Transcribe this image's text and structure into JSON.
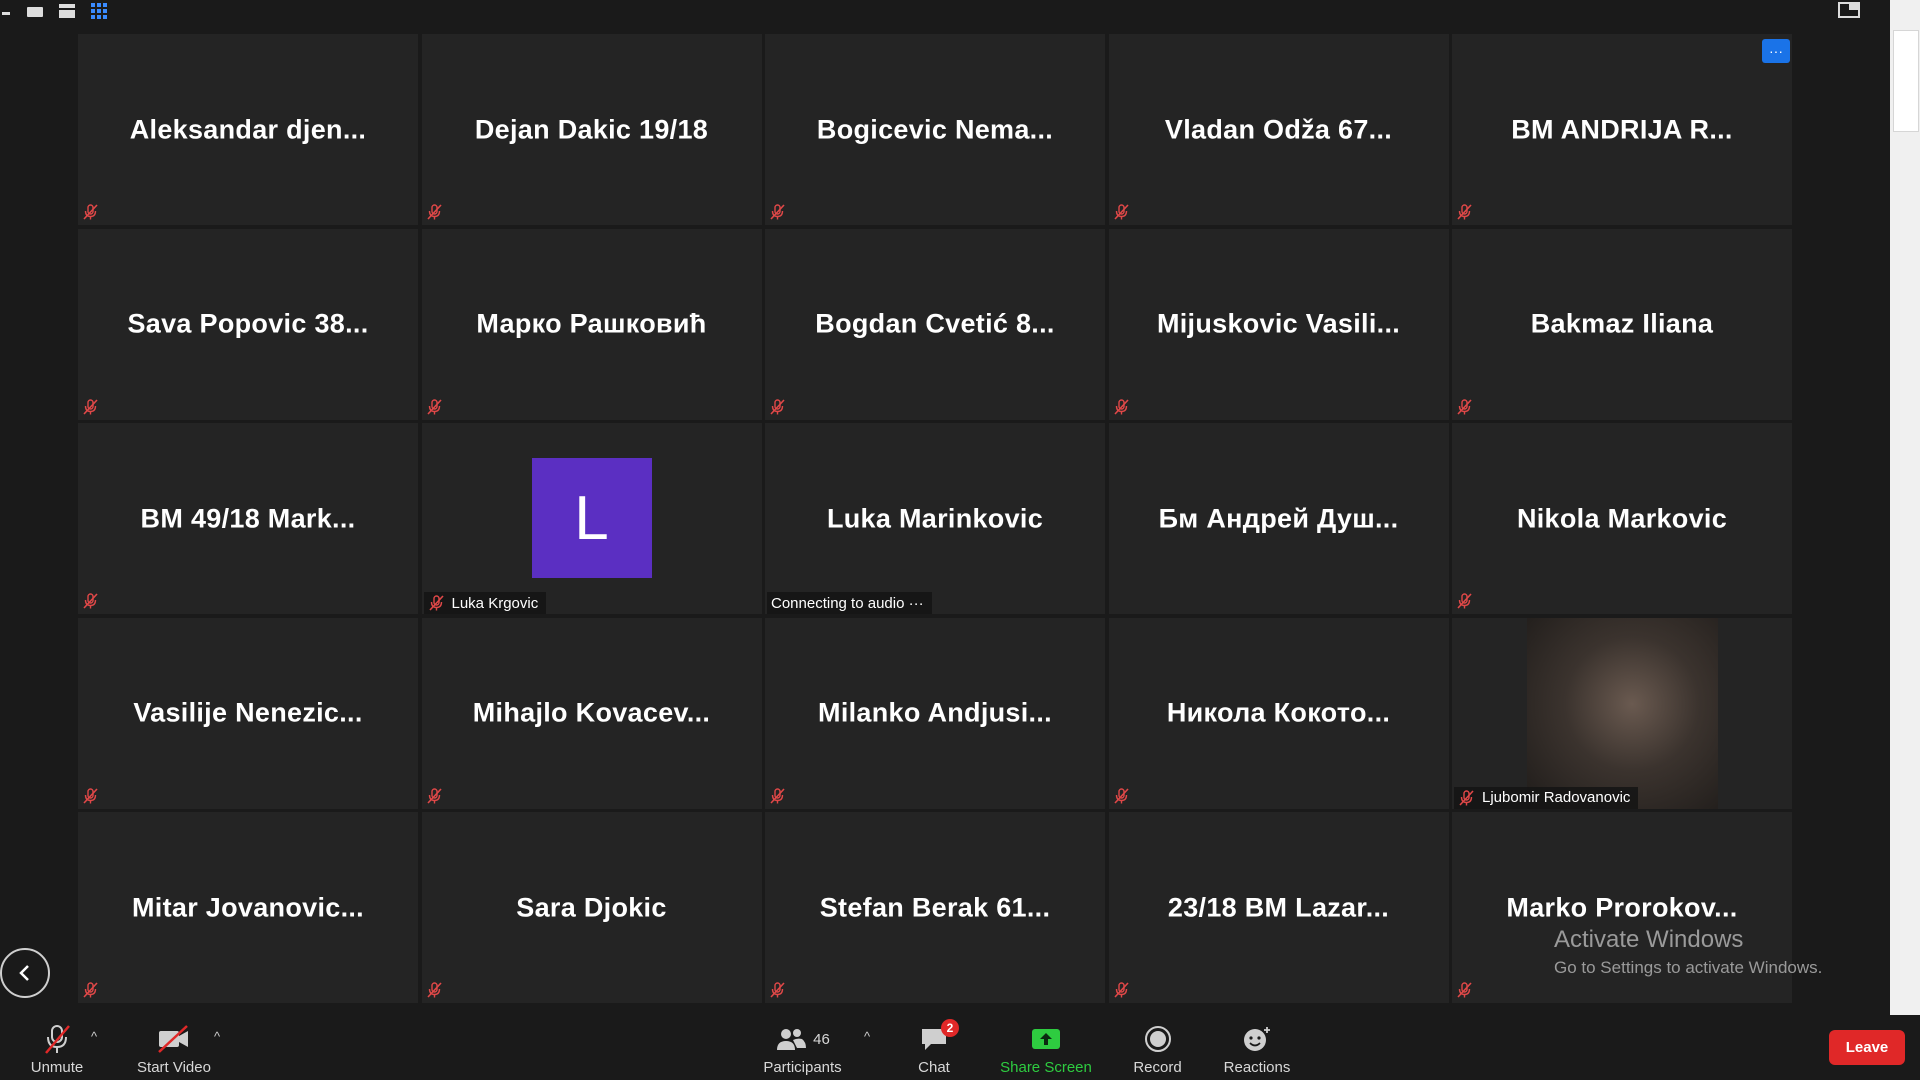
{
  "tiles": [
    {
      "name": "Aleksandar  djen...",
      "muted": true
    },
    {
      "name": "Dejan Dakic 19/18",
      "muted": true
    },
    {
      "name": "Bogicevic  Nema...",
      "muted": true
    },
    {
      "name": "Vladan Odža 67...",
      "muted": true
    },
    {
      "name": "BM ANDRIJA R...",
      "muted": true
    },
    {
      "name": "Sava Popovic 38...",
      "muted": true
    },
    {
      "name": "Марко Рашковић",
      "muted": true
    },
    {
      "name": "Bogdan Cvetić 8...",
      "muted": true
    },
    {
      "name": "Mijuskovic Vasili...",
      "muted": true
    },
    {
      "name": "Bakmaz Iliana",
      "muted": true
    },
    {
      "name": "BM 49/18 Mark...",
      "muted": true
    },
    {
      "name": "",
      "muted": false,
      "avatar_letter": "L",
      "label": "Luka Krgovic",
      "label_muted": true
    },
    {
      "name": "Luka Marinkovic",
      "muted": false,
      "label": "Connecting to audio ···"
    },
    {
      "name": "Бм Андрей Душ...",
      "muted": false
    },
    {
      "name": "Nikola Markovic",
      "muted": true
    },
    {
      "name": "Vasilije  Nenezic...",
      "muted": true
    },
    {
      "name": "Mihajlo  Kovacev...",
      "muted": true
    },
    {
      "name": "Milanko  Andjusi...",
      "muted": true
    },
    {
      "name": "Никола Кокото...",
      "muted": true
    },
    {
      "name": "",
      "muted": false,
      "video": true,
      "label": "Ljubomir Radovanovic",
      "label_muted": true
    },
    {
      "name": "Mitar  Jovanovic...",
      "muted": true
    },
    {
      "name": "Sara Djokic",
      "muted": true
    },
    {
      "name": "Stefan Berak 61...",
      "muted": true
    },
    {
      "name": "23/18 BM Lazar...",
      "muted": true
    },
    {
      "name": "Marko  Prorokov...",
      "muted": true
    }
  ],
  "more_button": "···",
  "watermark": {
    "title": "Activate Windows",
    "subtitle": "Go to Settings to activate Windows."
  },
  "toolbar": {
    "unmute": "Unmute",
    "start_video": "Start Video",
    "participants": "Participants",
    "participants_count": "46",
    "chat": "Chat",
    "chat_badge": "2",
    "share_screen": "Share Screen",
    "record": "Record",
    "reactions": "Reactions",
    "leave": "Leave"
  },
  "colors": {
    "avatar": "#5b2fc2",
    "share_screen": "#2ecc40",
    "leave": "#e02828",
    "more": "#1a73e8"
  }
}
